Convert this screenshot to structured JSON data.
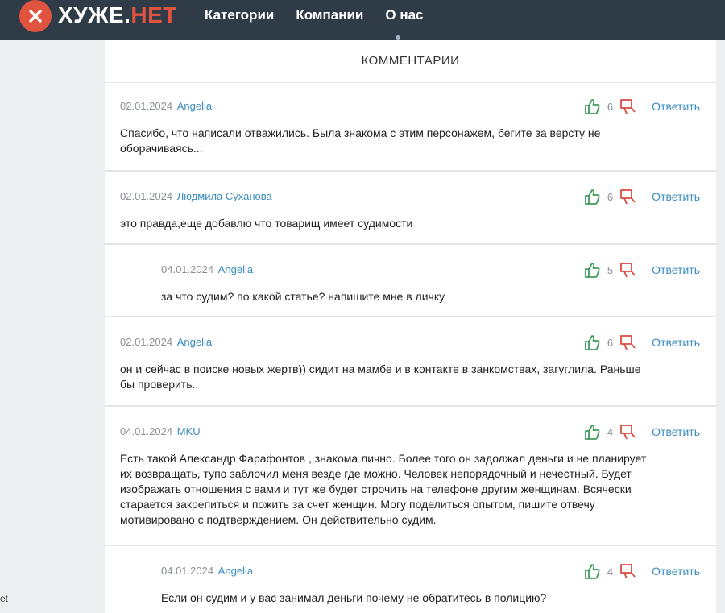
{
  "brand": {
    "name": "ХУЖЕ.",
    "tld": "НЕТ",
    "accent_color": "#e0533f",
    "header_color": "#2f3c48"
  },
  "nav": {
    "items": [
      "Категории",
      "Компании",
      "О нас"
    ]
  },
  "section_title": "КОММЕНТАРИИ",
  "comments": [
    {
      "date": "02.01.2024",
      "author": "Angelia",
      "likes": "6",
      "reply_label": "Ответить",
      "text": [
        "Спасибо, что написали отважились. Была знакома с этим персонажем, бегите за версту не",
        "оборачиваясь..."
      ]
    },
    {
      "date": "02.01.2024",
      "author": "Людмила Суханова",
      "likes": "6",
      "reply_label": "Ответить",
      "text": [
        "это правда,еще добавлю что товарищ имеет судимости"
      ]
    },
    {
      "date": "04.01.2024",
      "author": "Angelia",
      "likes": "5",
      "reply_label": "Ответить",
      "text": [
        "за что судим? по какой статье? напишите мне в личку"
      ]
    },
    {
      "date": "02.01.2024",
      "author": "Angelia",
      "likes": "6",
      "reply_label": "Ответить",
      "text": [
        "он и сейчас в поиске новых жертв)) сидит на мамбе и в контакте в занкомствах, загуглила. Раньше",
        "бы проверить.."
      ]
    },
    {
      "date": "04.01.2024",
      "author": "MKU",
      "likes": "4",
      "reply_label": "Ответить",
      "text": [
        "Есть такой Александр Фарафонтов , знакома лично. Более того он задолжал деньги и не планирует",
        "их возвращать, тупо заблочил меня везде где можно. Человек непорядочный и нечестный. Будет",
        "изображать отношения с вами и тут же будет строчить на телефоне другим женщинам. Всячески",
        "старается закрепиться и пожить за счет женщин. Могу поделиться опытом, пишите отвечу",
        "мотивировано с подтверждением. Он действительно судим."
      ]
    },
    {
      "date": "04.01.2024",
      "author": "Angelia",
      "likes": "4",
      "reply_label": "Ответить",
      "text": [
        "Если он судим и у вас занимал деньги почему не обратитесь в полицию?"
      ]
    }
  ],
  "side_clip": "et",
  "colors": {
    "like": "#3e9b5c",
    "dislike": "#d94b40",
    "link": "#3a8dc0"
  }
}
